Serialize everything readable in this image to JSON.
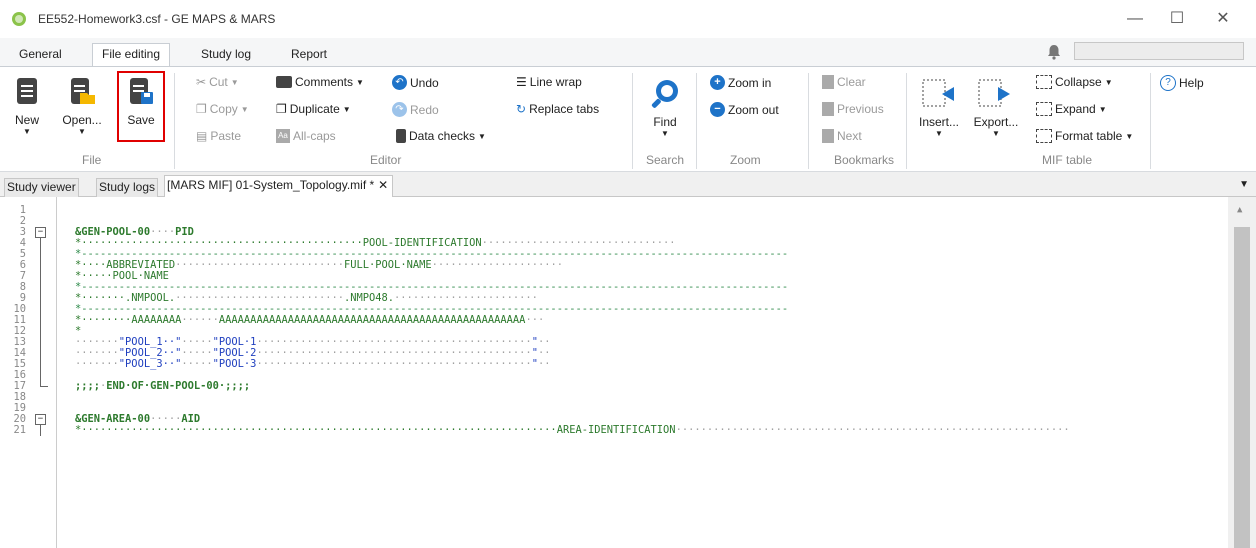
{
  "window": {
    "title": "EE552-Homework3.csf - GE MAPS & MARS",
    "controls": {
      "minimize": "—",
      "maximize": "☐",
      "close": "✕"
    }
  },
  "menu_tabs": [
    {
      "label": "General"
    },
    {
      "label": "File editing",
      "active": true
    },
    {
      "label": "Study log"
    },
    {
      "label": "Report"
    }
  ],
  "ribbon": {
    "file": {
      "new": "New",
      "open": "Open...",
      "save": "Save",
      "group": "File"
    },
    "editor": {
      "cut": "Cut",
      "copy": "Copy",
      "paste": "Paste",
      "comments": "Comments",
      "duplicate": "Duplicate",
      "allcaps": "All-caps",
      "undo": "Undo",
      "redo": "Redo",
      "data_checks": "Data checks",
      "line_wrap": "Line wrap",
      "replace_tabs": "Replace tabs",
      "group": "Editor"
    },
    "search": {
      "find": "Find",
      "group": "Search"
    },
    "zoom": {
      "zoom_in": "Zoom in",
      "zoom_out": "Zoom out",
      "group": "Zoom"
    },
    "bookmarks": {
      "clear": "Clear",
      "previous": "Previous",
      "next": "Next",
      "group": "Bookmarks"
    },
    "mif": {
      "insert": "Insert...",
      "export": "Export...",
      "collapse": "Collapse",
      "expand": "Expand",
      "format_table": "Format table",
      "group": "MIF table"
    },
    "help": "Help"
  },
  "doc_tabs": {
    "study_viewer": "Study viewer",
    "study_logs": "Study logs",
    "active": "[MARS MIF] 01-System_Topology.mif *",
    "close": "✕"
  },
  "editor": {
    "line_numbers": [
      "1",
      "2",
      "3",
      "4",
      "5",
      "6",
      "7",
      "8",
      "9",
      "10",
      "11",
      "12",
      "13",
      "14",
      "15",
      "16",
      "17",
      "18",
      "19",
      "20",
      "21"
    ],
    "lines": {
      "l3a": "&GEN-POOL-00",
      "l3b": "····",
      "l3c": "PID",
      "l4a": "*·············································",
      "l4b": "POOL-IDENTIFICATION",
      "l4c": "·······························",
      "dashline": "*-----------------------------------------------------------------------------------------------------------------",
      "l6a": "*····",
      "l6b": "ABBREVIATED",
      "l6c": "···························",
      "l6d": "FULL·POOL·NAME",
      "l6e": "·····················",
      "l7a": "*·····",
      "l7b": "POOL·NAME",
      "l9a": "*·······",
      "l9b": ".NMPOOL.",
      "l9c": "···························",
      "l9d": ".NMPO48.",
      "l9e": "·······················",
      "l11a": "*········",
      "l11b": "AAAAAAAA",
      "l11c": "······",
      "l11d": "AAAAAAAAAAAAAAAAAAAAAAAAAAAAAAAAAAAAAAAAAAAAAAAAA",
      "l11e": "···",
      "l12": "*",
      "p1a": "·······",
      "p1b": "\"POOL_1··\"",
      "p1c": "·····",
      "p1d": "\"POOL·1",
      "p1e": "············································",
      "p1f": "\"",
      "p1g": "··",
      "p2b": "\"POOL_2··\"",
      "p2d": "\"POOL·2",
      "p3b": "\"POOL_3··\"",
      "p3d": "\"POOL·3",
      "l17a": ";;;;",
      "l17b": "·",
      "l17c": "END·OF·GEN-POOL-00·;;;;",
      "l20a": "&GEN-AREA-00",
      "l20b": "·····",
      "l20c": "AID",
      "l21a": "*············································································",
      "l21b": "AREA-IDENTIFICATION",
      "l21c": "·······························································"
    }
  },
  "colors": {
    "accent": "#1e73c8",
    "highlight": "#e00000",
    "code_green": "#2d7a2d",
    "code_blue": "#1f3fbf"
  }
}
